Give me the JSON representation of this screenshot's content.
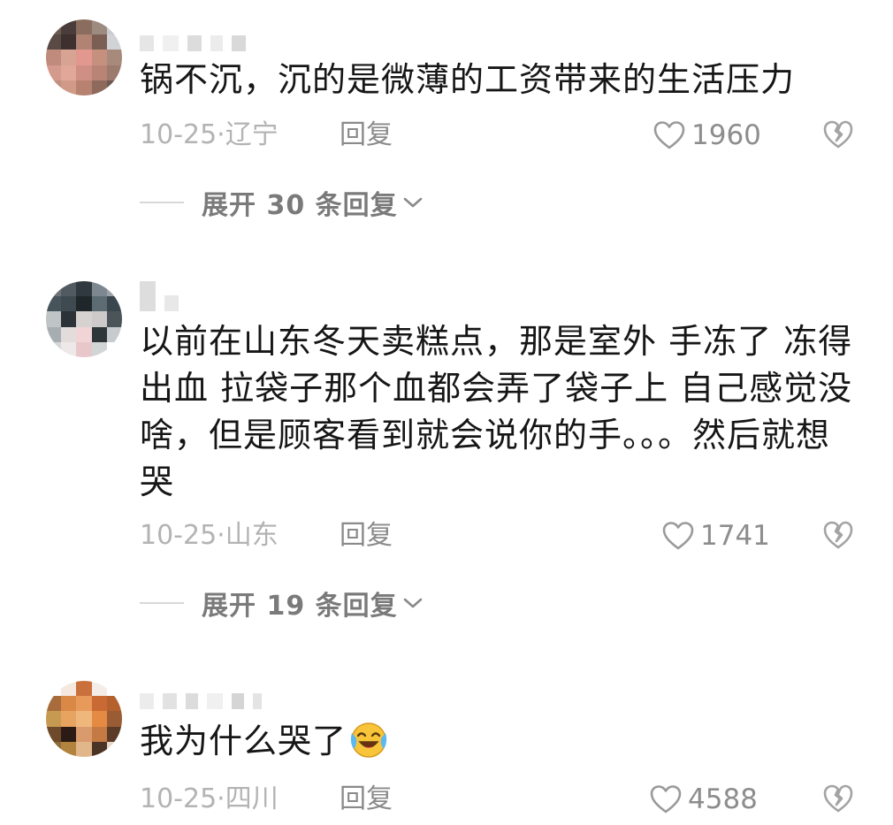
{
  "comments": [
    {
      "text": "锅不沉，沉的是微薄的工资带来的生活压力",
      "date": "10-25·辽宁",
      "reply_label": "回复",
      "likes": "1960",
      "expand_label": "展开 30 条回复"
    },
    {
      "text": "以前在山东冬天卖糕点，那是室外 手冻了 冻得出血 拉袋子那个血都会弄了袋子上 自己感觉没啥，但是顾客看到就会说你的手。。。然后就想哭",
      "date": "10-25·山东",
      "reply_label": "回复",
      "likes": "1741",
      "expand_label": "展开 19 条回复"
    },
    {
      "text": "我为什么哭了",
      "emoji": "crying-laughing-emoji",
      "date": "10-25·四川",
      "reply_label": "回复",
      "likes": "4588"
    }
  ],
  "icons": {
    "like": "heart-outline-icon",
    "dislike": "broken-heart-icon",
    "expand": "chevron-down-icon"
  },
  "colors": {
    "background": "#ffffff",
    "text": "#161616",
    "meta": "#b3b3b3",
    "action": "#8a8a8a"
  }
}
